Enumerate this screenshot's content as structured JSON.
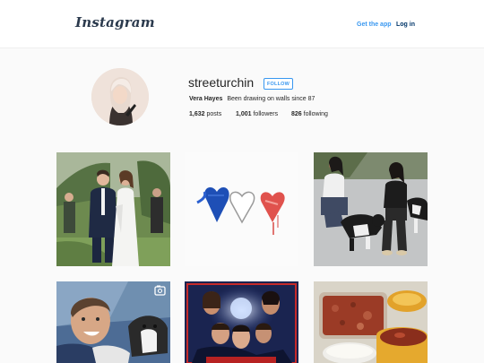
{
  "header": {
    "logo": "Instagram",
    "get_app": "Get the app",
    "login": "Log in"
  },
  "profile": {
    "username": "streeturchin",
    "follow_label": "FOLLOW",
    "full_name": "Vera Hayes",
    "bio": "Been drawing on walls since 87",
    "posts_count": "1,632",
    "posts_label": "posts",
    "followers_count": "1,001",
    "followers_label": "followers",
    "following_count": "826",
    "following_label": "following"
  },
  "posts": [
    {
      "name": "wedding-couple-photo"
    },
    {
      "name": "three-hearts-painting"
    },
    {
      "name": "two-women-with-dogs-photo"
    },
    {
      "name": "man-with-dog-video"
    },
    {
      "name": "stranger-things-poster"
    },
    {
      "name": "baked-dishes-photo"
    }
  ],
  "colors": {
    "link": "#3897f0",
    "login": "#003569",
    "logo": "#2b3a4d"
  }
}
